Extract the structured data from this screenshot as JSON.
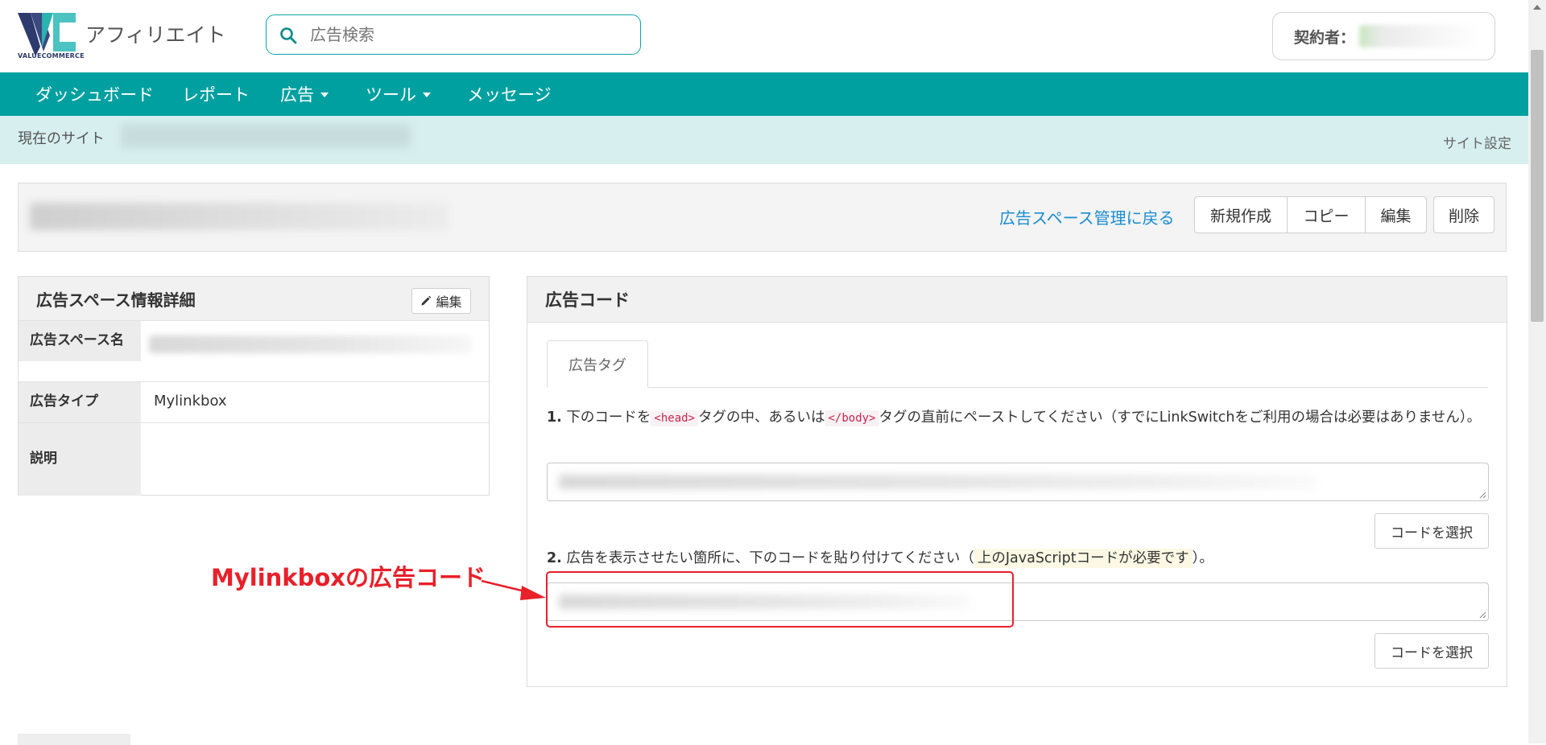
{
  "header": {
    "logo_sub": "VALUECOMMERCE",
    "brand_name": "アフィリエイト",
    "search_placeholder": "広告検索",
    "contractor_label": "契約者："
  },
  "nav": {
    "items": [
      {
        "label": "ダッシュボード"
      },
      {
        "label": "レポート"
      },
      {
        "label": "広告"
      },
      {
        "label": "ツール"
      },
      {
        "label": "メッセージ"
      }
    ]
  },
  "sitebar": {
    "label": "現在のサイト",
    "settings": "サイト設定"
  },
  "title_panel": {
    "back_link": "広告スペース管理に戻る",
    "buttons": [
      "新規作成",
      "コピー",
      "編集",
      "削除"
    ]
  },
  "info_panel": {
    "title": "広告スペース情報詳細",
    "edit_label": "編集",
    "rows": [
      {
        "key": "広告スペース名",
        "value": ""
      },
      {
        "key": "広告タイプ",
        "value": "Mylinkbox"
      },
      {
        "key": "説明",
        "value": ""
      }
    ]
  },
  "code_panel": {
    "title": "広告コード",
    "tab": "広告タグ",
    "step1": {
      "num": "1.",
      "text_a": "下のコードを",
      "tag_head": "<head>",
      "text_b": "タグの中、あるいは",
      "tag_body": "</body>",
      "text_c": "タグの直前にペーストしてください（すでにLinkSwitchをご利用の場合は必要はありません）。"
    },
    "step2": {
      "num": "2.",
      "text_a": "広告を表示させたい箇所に、下のコードを貼り付けてください（",
      "highlight": "上のJavaScriptコードが必要です",
      "text_b": "）。"
    },
    "select_code_label": "コードを選択"
  },
  "annotation": {
    "text": "Mylinkboxの広告コード",
    "color": "#e8202a"
  },
  "colors": {
    "brand_teal": "#00a0a0",
    "site_bar": "#d7efef",
    "link_blue": "#1a8bd1"
  }
}
